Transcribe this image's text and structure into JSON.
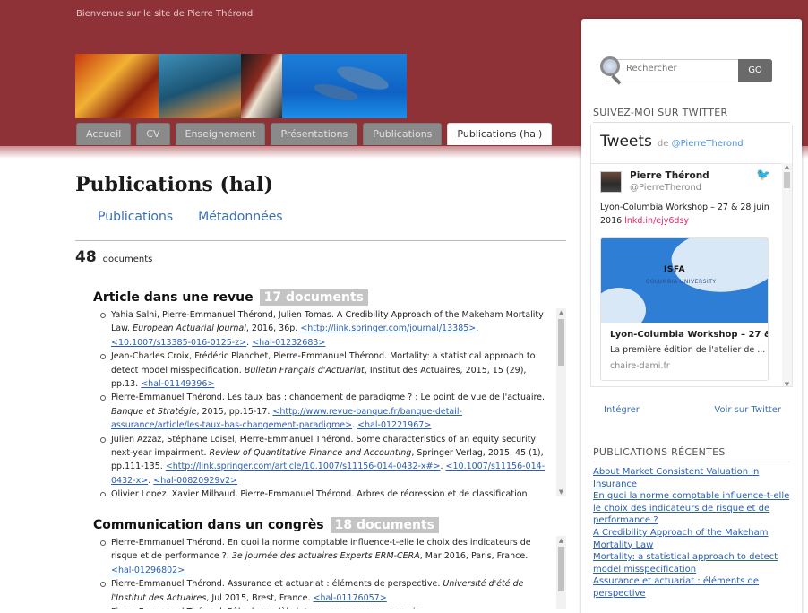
{
  "header": {
    "welcome": "Bienvenue sur le site de Pierre Thérond"
  },
  "tabs": [
    "Accueil",
    "CV",
    "Enseignement",
    "Présentations",
    "Publications",
    "Publications (hal)"
  ],
  "main": {
    "title": "Publications (hal)",
    "subnav": [
      "Publications",
      "Métadonnées"
    ],
    "count": "48",
    "count_label": "documents"
  },
  "sections": [
    {
      "title": "Article dans une revue",
      "badge": "17 documents",
      "items": [
        [
          {
            "t": "Yahia Salhi, Pierre-Emmanuel Thérond, Julien Tomas. A Credibility Approach of the Makeham Mortality Law. "
          },
          {
            "t": "European Actuarial Journal",
            "i": true
          },
          {
            "t": ", 2016, 36p. "
          },
          {
            "t": "<http://link.springer.com/journal/13385>",
            "a": true
          },
          {
            "t": ". "
          },
          {
            "t": "<10.1007/s13385-016-0125-z>",
            "a": true
          },
          {
            "t": ". "
          },
          {
            "t": "<hal-01232683>",
            "a": true
          }
        ],
        [
          {
            "t": "Jean-Charles Croix, Frédéric Planchet, Pierre-Emmanuel Thérond. Mortality: a statistical approach to detect model misspecification. "
          },
          {
            "t": "Bulletin Français d'Actuariat",
            "i": true
          },
          {
            "t": ", Institut des Actuaires, 2015, 15 (29), pp.13. "
          },
          {
            "t": "<hal-01149396>",
            "a": true
          }
        ],
        [
          {
            "t": "Pierre-Emmanuel Thérond. Les taux bas : changement de paradigme ? : Le point de vue de l'actuaire. "
          },
          {
            "t": "Banque et Stratégie",
            "i": true
          },
          {
            "t": ", 2015, pp.15-17. "
          },
          {
            "t": "<http://www.revue-banque.fr/banque-detail-assurance/article/les-taux-bas-changement-paradigme>",
            "a": true
          },
          {
            "t": ". "
          },
          {
            "t": "<hal-01221967>",
            "a": true
          }
        ],
        [
          {
            "t": "Julien Azzaz, Stéphane Loisel, Pierre-Emmanuel Thérond. Some characteristics of an equity security next-year impairment. "
          },
          {
            "t": "Review of Quantitative Finance and Accounting",
            "i": true
          },
          {
            "t": ", Springer Verlag, 2015, 45 (1), pp.111-135. "
          },
          {
            "t": "<http://link.springer.com/article/10.1007/s11156-014-0432-x#>",
            "a": true
          },
          {
            "t": ". "
          },
          {
            "t": "<10.1007/s11156-014-0432-x>",
            "a": true
          },
          {
            "t": ". "
          },
          {
            "t": "<hal-00820929v2>",
            "a": true
          }
        ],
        [
          {
            "t": "Olivier Lopez, Xavier Milhaud, Pierre-Emmanuel Thérond. Arbres de régression et de classification"
          }
        ]
      ]
    },
    {
      "title": "Communication dans un congrès",
      "badge": "18 documents",
      "items": [
        [
          {
            "t": "Pierre-Emmanuel Thérond. En quoi la norme comptable influence-t-elle le choix des indicateurs de risque et de performance ?. "
          },
          {
            "t": "3e journée des actuaires Experts ERM-CERA",
            "i": true
          },
          {
            "t": ", Mar 2016, Paris, France. "
          },
          {
            "t": "<hal-01296802>",
            "a": true
          }
        ],
        [
          {
            "t": "Pierre-Emmanuel Thérond. Assurance et actuariat : éléments de perspective. "
          },
          {
            "t": "Université d'été de l'Institut des Actuaires",
            "i": true
          },
          {
            "t": ", Jul 2015, Brest, France. "
          },
          {
            "t": "<hal-01176057>",
            "a": true
          }
        ],
        [
          {
            "t": "Pierre-Emmanuel Thérond. Rôle du modèle interne en assurance non-vie"
          }
        ]
      ]
    }
  ],
  "sidebar": {
    "search_placeholder": "Rechercher",
    "search_button": "GO",
    "twitter_heading": "SUIVEZ-MOI SUR TWITTER",
    "tweets_title": "Tweets",
    "tweets_by": "de",
    "tweets_handle": "@PierreTherond",
    "tweet": {
      "name": "Pierre Thérond",
      "user": "@PierreTherond",
      "text": "Lyon-Columbia Workshop – 27 & 28 juin 2016 ",
      "link": "lnkd.in/ejy6dsy",
      "card_title": "Lyon-Columbia Workshop – 27 &...",
      "card_desc": "La première édition de l'atelier de ...",
      "card_domain": "chaire-dami.fr",
      "card_logo": "ISFA",
      "card_logo2": "COLUMBIA UNIVERSITY"
    },
    "embed_label": "Intégrer",
    "view_label": "Voir sur Twitter",
    "recent_heading": "PUBLICATIONS RÉCENTES",
    "recent": [
      "About Market Consistent Valuation in Insurance",
      "En quoi la norme comptable influence-t-elle le choix des indicateurs de risque et de performance ?",
      "A Credibility Approach of the Makeham Mortality Law",
      "Mortality: a statistical approach to detect model misspecification",
      "Assurance et actuariat : éléments de perspective"
    ]
  }
}
